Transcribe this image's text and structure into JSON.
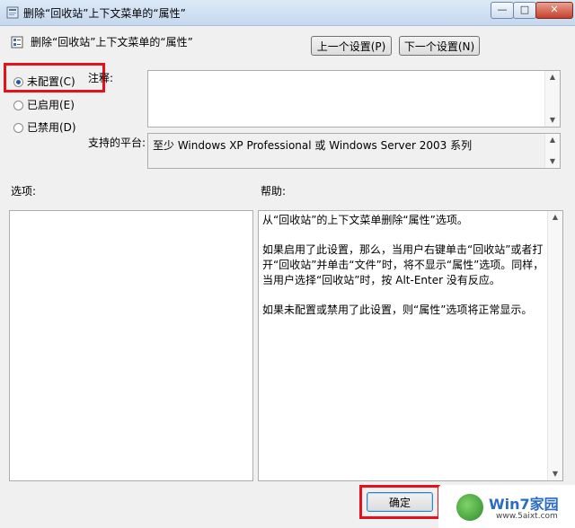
{
  "window": {
    "title": "删除“回收站”上下文菜单的“属性”",
    "minimize": "—",
    "maximize": "□",
    "close": "✕"
  },
  "header": {
    "title": "删除“回收站”上下文菜单的“属性”",
    "prev_button": "上一个设置(P)",
    "next_button": "下一个设置(N)"
  },
  "state": {
    "options": [
      {
        "label": "未配置(C)",
        "checked": true
      },
      {
        "label": "已启用(E)",
        "checked": false
      },
      {
        "label": "已禁用(D)",
        "checked": false
      }
    ]
  },
  "comment": {
    "label": "注释:",
    "value": ""
  },
  "platform": {
    "label": "支持的平台:",
    "value": "至少 Windows XP Professional 或 Windows Server 2003 系列"
  },
  "options_label": "选项:",
  "help": {
    "label": "帮助:",
    "paragraphs": [
      "从“回收站”的上下文菜单删除“属性”选项。",
      "如果启用了此设置，那么，当用户右键单击“回收站”或者打开“回收站”并单击“文件”时，将不显示“属性”选项。同样，当用户选择“回收站”时，按 Alt-Enter 没有反应。",
      "如果未配置或禁用了此设置，则“属性”选项将正常显示。"
    ]
  },
  "footer": {
    "ok_button": "确定"
  },
  "watermark": {
    "text": "Win7家园",
    "url": "www.5aixt.com"
  },
  "colors": {
    "highlight": "#e8101b"
  },
  "icons": {
    "title": "policy-icon",
    "header": "policy-settings-icon",
    "scroll_up": "arrow-up-icon",
    "scroll_down": "arrow-down-icon"
  }
}
